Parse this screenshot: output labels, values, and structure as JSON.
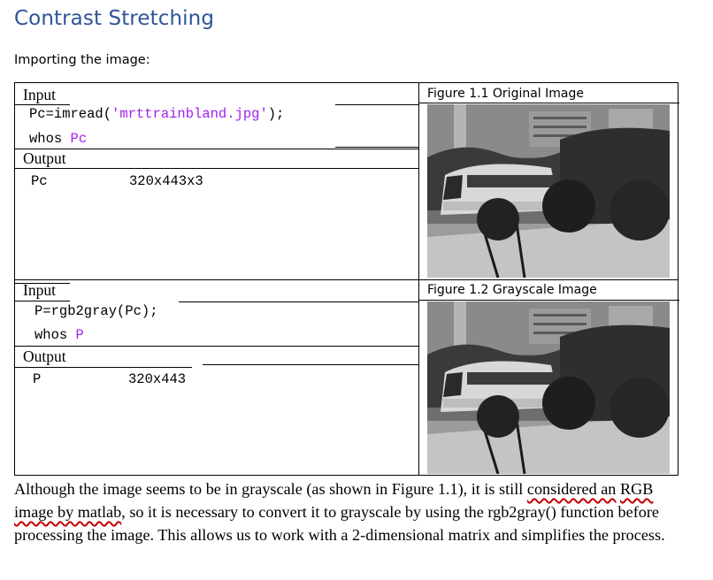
{
  "heading": "Contrast Stretching",
  "subheading": "Importing the image:",
  "blocks": [
    {
      "input_label": "Input",
      "code_line1": "Pc=imread(",
      "code_line1_str": "'mrttrainbland.jpg'",
      "code_line1_end": ");",
      "code_line2": "whos ",
      "code_line2_var": "Pc",
      "output_label": "Output",
      "output_name": "Pc",
      "output_value": "320x443x3",
      "figure_caption": "Figure 1.1 Original Image"
    },
    {
      "input_label": "Input",
      "code_line1": "P=rgb2gray(Pc);",
      "code_line2": "whos ",
      "code_line2_var": "P",
      "output_label": "Output",
      "output_name": "P",
      "output_value": "320x443",
      "figure_caption": "Figure 1.2 Grayscale Image"
    }
  ],
  "paragraph": {
    "part1": "Although the image seems to be in grayscale (as shown in Figure 1.1), it is still ",
    "flagged1": "considered an",
    "part2": " ",
    "flagged2": "RGB image by matlab",
    "part3": ", so it is necessary to convert it to grayscale by using the rgb2gray() function before processing the image. This allows us to work with a 2-dimensional matrix and simplifies the process."
  },
  "colors": {
    "heading": "#2f5496",
    "string_literal": "#a020f0",
    "spell_underline": "#c00000"
  }
}
